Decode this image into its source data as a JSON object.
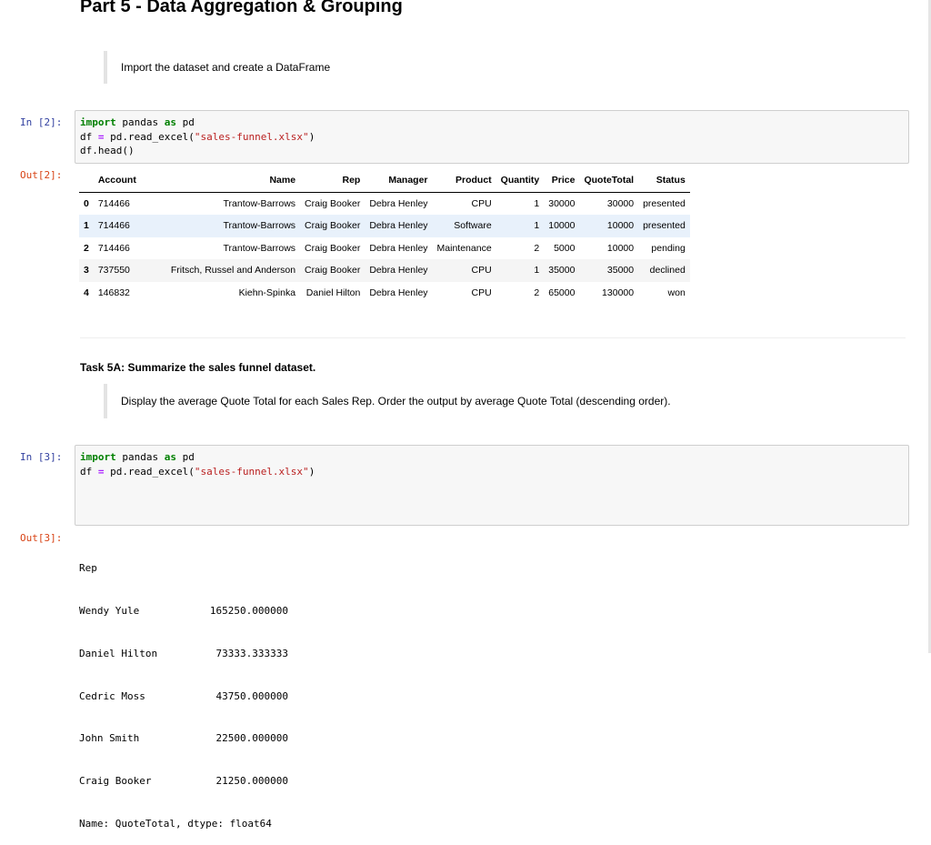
{
  "heading": "Part 5 - Data Aggregation & Grouping",
  "markdown1": "Import the dataset and create a DataFrame",
  "cell2": {
    "in_prompt": "In [2]:",
    "out_prompt": "Out[2]:",
    "code": {
      "line1": {
        "kw1": "import",
        "mod": " pandas ",
        "kw2": "as",
        "alias": " pd"
      },
      "line2": {
        "pre": "df ",
        "op": "=",
        "mid": " pd.read_excel(",
        "str": "\"sales-funnel.xlsx\"",
        "post": ")"
      },
      "line3": "df.head()"
    }
  },
  "table": {
    "columns": [
      "",
      "Account",
      "Name",
      "Rep",
      "Manager",
      "Product",
      "Quantity",
      "Price",
      "QuoteTotal",
      "Status"
    ],
    "rows": [
      [
        "0",
        "714466",
        "Trantow-Barrows",
        "Craig Booker",
        "Debra Henley",
        "CPU",
        "1",
        "30000",
        "30000",
        "presented"
      ],
      [
        "1",
        "714466",
        "Trantow-Barrows",
        "Craig Booker",
        "Debra Henley",
        "Software",
        "1",
        "10000",
        "10000",
        "presented"
      ],
      [
        "2",
        "714466",
        "Trantow-Barrows",
        "Craig Booker",
        "Debra Henley",
        "Maintenance",
        "2",
        "5000",
        "10000",
        "pending"
      ],
      [
        "3",
        "737550",
        "Fritsch, Russel and Anderson",
        "Craig Booker",
        "Debra Henley",
        "CPU",
        "1",
        "35000",
        "35000",
        "declined"
      ],
      [
        "4",
        "146832",
        "Kiehn-Spinka",
        "Daniel Hilton",
        "Debra Henley",
        "CPU",
        "2",
        "65000",
        "130000",
        "won"
      ]
    ]
  },
  "task_title": "Task 5A: Summarize the sales funnel dataset.",
  "markdown2": "Display the average Quote Total for each Sales Rep. Order the output by average Quote Total (descending order).",
  "cell3": {
    "in_prompt": "In [3]:",
    "out_prompt": "Out[3]:",
    "code": {
      "line1": {
        "kw1": "import",
        "mod": " pandas ",
        "kw2": "as",
        "alias": " pd"
      },
      "line2": {
        "pre": "df ",
        "op": "=",
        "mid": " pd.read_excel(",
        "str": "\"sales-funnel.xlsx\"",
        "post": ")"
      }
    },
    "output": {
      "index_name": "Rep",
      "rows": [
        {
          "name": "Wendy Yule",
          "value": "165250.000000"
        },
        {
          "name": "Daniel Hilton",
          "value": "73333.333333"
        },
        {
          "name": "Cedric Moss",
          "value": "43750.000000"
        },
        {
          "name": "John Smith",
          "value": "22500.000000"
        },
        {
          "name": "Craig Booker",
          "value": "21250.000000"
        }
      ],
      "footer": "Name: QuoteTotal, dtype: float64"
    }
  },
  "colors": {
    "in_prompt": "#303f9f",
    "out_prompt": "#d84315",
    "keyword": "#008000",
    "string": "#ba2121",
    "operator": "#aa22ff",
    "highlight_row": "#e8f1fb"
  }
}
